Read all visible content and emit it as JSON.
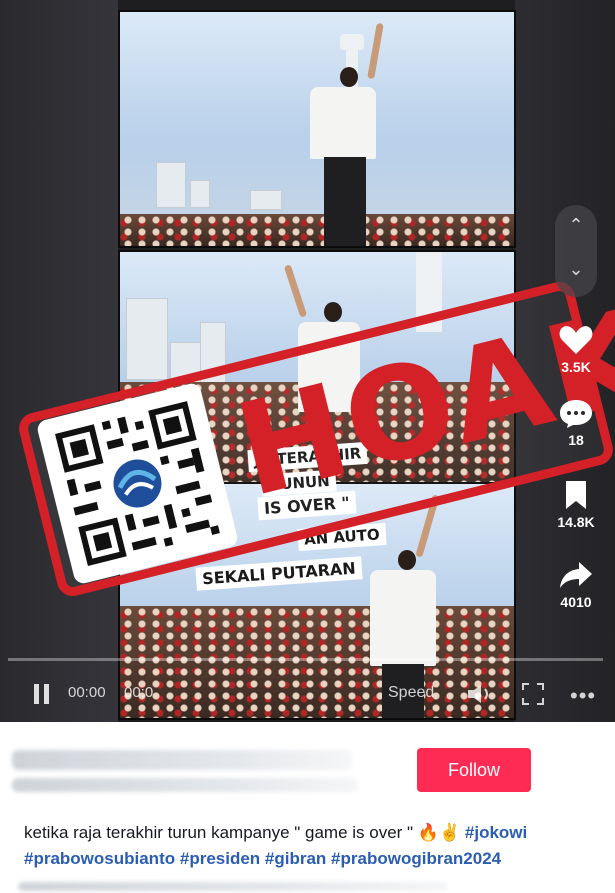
{
  "video": {
    "overlay_text": {
      "line1": "JA TERAKHIR",
      "line2": "GUNUN",
      "line3": "IS OVER \"",
      "line4": "AN AUTO",
      "line5": "SEKALI PUTARAN"
    },
    "stamp_text": "HOAKS",
    "controls": {
      "time_current": "00:00",
      "time_total": "00:0",
      "speed_label": "Speed"
    }
  },
  "rail": {
    "likes": "3.5K",
    "comments": "18",
    "saves": "14.8K",
    "shares": "4010"
  },
  "post": {
    "follow_label": "Follow",
    "caption_text": "ketika raja terakhir turun kampanye \" game is over \"",
    "caption_emojis": "🔥✌",
    "hashtags": [
      "#jokowi",
      "#prabowosubianto",
      "#presiden",
      "#gibran",
      "#prabowogibran2024"
    ]
  },
  "colors": {
    "stamp_red": "#d42027",
    "follow_red": "#fe2c55",
    "hashtag_blue": "#2b5db4"
  }
}
